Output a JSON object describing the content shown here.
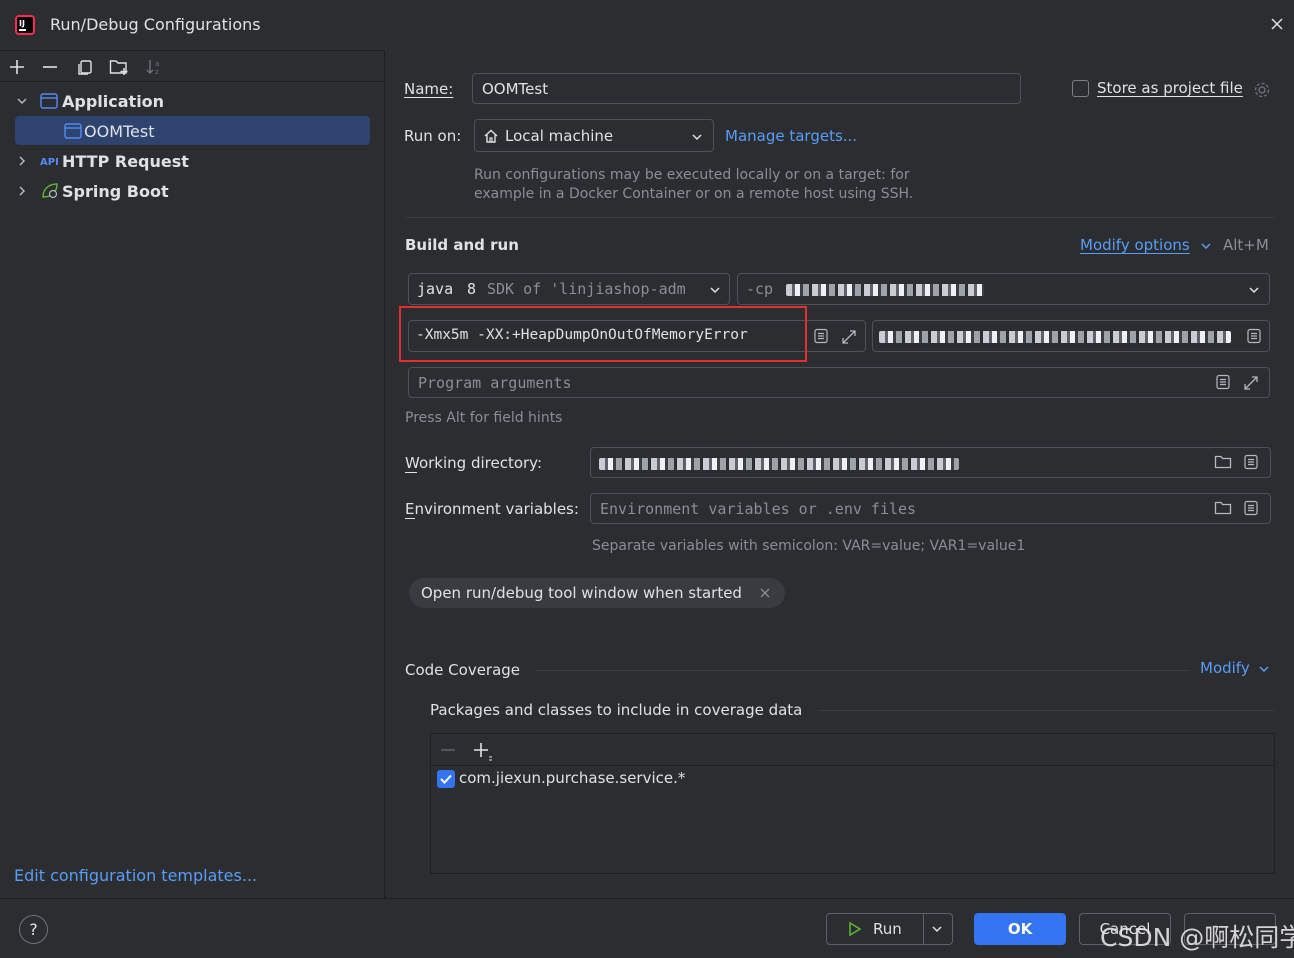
{
  "window": {
    "title": "Run/Debug Configurations"
  },
  "tree": {
    "items": [
      {
        "label": "Application"
      },
      {
        "label": "OOMTest"
      },
      {
        "label": "HTTP Request"
      },
      {
        "label": "Spring Boot"
      }
    ],
    "edit_templates_link": "Edit configuration templates..."
  },
  "form": {
    "name_label": "Name:",
    "name_value": "OOMTest",
    "store_label": "Store as project file",
    "store_checked": false,
    "run_on_label": "Run on:",
    "run_on_value": "Local machine",
    "manage_targets": "Manage targets...",
    "run_on_hint_1": "Run configurations may be executed locally or on a target: for",
    "run_on_hint_2": "example in a Docker Container or on a remote host using SSH.",
    "build_run_title": "Build and run",
    "modify_options": "Modify options",
    "modify_shortcut": "Alt+M",
    "jdk_java": "java",
    "jdk_version": "8",
    "jdk_rest": "SDK of 'linjiashop-adm",
    "cp_prefix": "-cp",
    "vm_options": "-Xmx5m -XX:+HeapDumpOnOutOfMemoryError",
    "program_args_placeholder": "Program arguments",
    "field_hint": "Press Alt for field hints",
    "working_dir_label": "Working directory:",
    "env_label": "Environment variables:",
    "env_placeholder": "Environment variables or .env files",
    "env_hint": "Separate variables with semicolon: VAR=value; VAR1=value1",
    "tag_label": "Open run/debug tool window when started"
  },
  "coverage": {
    "title": "Code Coverage",
    "modify": "Modify",
    "packages_title": "Packages and classes to include in coverage data",
    "entries": [
      {
        "label": "com.jiexun.purchase.service.*",
        "checked": true
      }
    ]
  },
  "footer": {
    "help": "?",
    "run": "Run",
    "ok": "OK",
    "cancel": "Cancel"
  },
  "watermark": "CSDN @啊松同学",
  "colors": {
    "accent": "#3574f0",
    "link": "#589df6",
    "highlight_box": "#e03131",
    "selection": "#2e436e"
  }
}
